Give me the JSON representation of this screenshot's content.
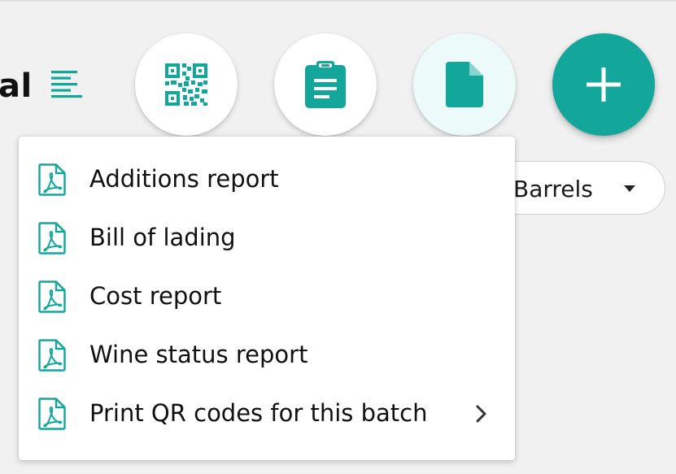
{
  "header": {
    "title_fragment": "al"
  },
  "toolbar": {
    "buttons": [
      {
        "name": "qr-code",
        "icon": "qr-code-icon"
      },
      {
        "name": "clipboard",
        "icon": "clipboard-icon"
      },
      {
        "name": "document",
        "icon": "document-icon"
      },
      {
        "name": "add",
        "icon": "plus-icon"
      }
    ]
  },
  "filter": {
    "selected": "Barrels"
  },
  "reports_menu": {
    "items": [
      {
        "label": "Additions report",
        "icon": "pdf-icon"
      },
      {
        "label": "Bill of lading",
        "icon": "pdf-icon"
      },
      {
        "label": "Cost report",
        "icon": "pdf-icon"
      },
      {
        "label": "Wine status report",
        "icon": "pdf-icon"
      },
      {
        "label": "Print QR codes for this batch",
        "icon": "pdf-icon",
        "has_submenu": true
      }
    ]
  },
  "colors": {
    "accent": "#13a69b",
    "background": "#f1f1f1",
    "surface": "#ffffff",
    "doc_button_tint": "#ecfafa",
    "text": "#111111"
  }
}
